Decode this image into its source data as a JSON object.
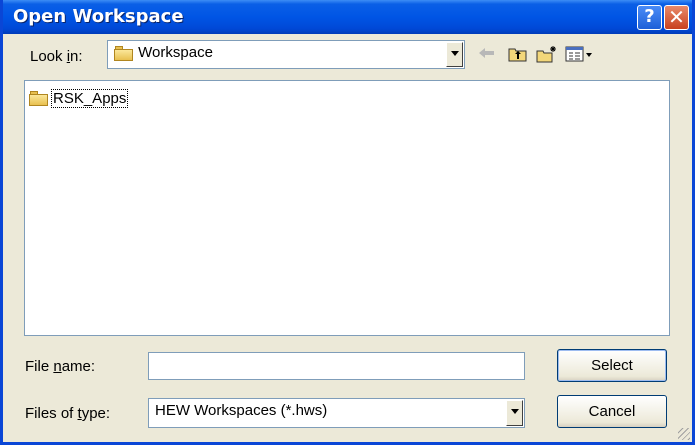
{
  "title": "Open Workspace",
  "title_buttons": {
    "help": "?",
    "close": "✕"
  },
  "look_in": {
    "label_pre": "Look ",
    "label_accel": "i",
    "label_post": "n:",
    "value": "Workspace"
  },
  "toolbar_icons": {
    "back": "back-arrow-icon",
    "up_folder": "up-one-level-icon",
    "new_folder": "new-folder-icon",
    "view_menu": "view-menu-icon"
  },
  "files": [
    {
      "name": "RSK_Apps",
      "icon": "folder-icon"
    }
  ],
  "file_name": {
    "label_pre": "File ",
    "label_accel": "n",
    "label_post": "ame:",
    "value": ""
  },
  "file_type": {
    "label_pre": "Files of ",
    "label_accel": "t",
    "label_post": "ype:",
    "value": "HEW Workspaces (*.hws)"
  },
  "buttons": {
    "select": "Select",
    "cancel": "Cancel"
  },
  "colors": {
    "titlebar": "#0055e5",
    "window_bg": "#ece9d8",
    "field_border": "#7f9db9"
  }
}
